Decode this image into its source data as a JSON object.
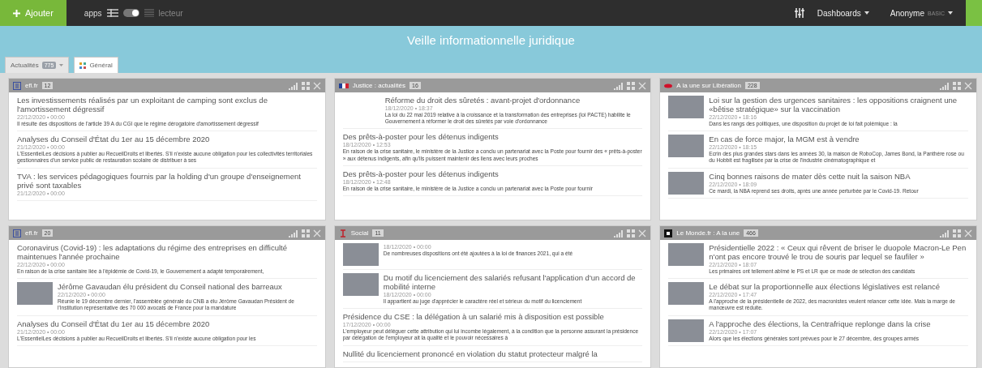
{
  "topbar": {
    "add_button": "Ajouter",
    "apps_label": "apps",
    "mode_toggle_on": true,
    "reader_label": "lecteur",
    "dashboards_menu": "Dashboards",
    "user_name": "Anonyme",
    "user_plan": "BASIC"
  },
  "banner": {
    "title": "Veille informationnelle juridique"
  },
  "tabs": [
    {
      "label": "Actualités",
      "count": "775",
      "kind": "group",
      "selected": false
    },
    {
      "label": "Général",
      "kind": "page",
      "selected": true
    }
  ],
  "panels": [
    {
      "source": "efl.fr",
      "count": "12",
      "items": [
        {
          "kind": "text",
          "title": "Les investissements réalisés par un exploitant de camping sont exclus de l'amortissement dégressif",
          "date": "22/12/2020 • 00:00",
          "summary": "Il résulte des dispositions de l'article 39 A du CGI que le régime dérogatoire d'amortissement dégressif"
        },
        {
          "kind": "text",
          "title": "Analyses du Conseil d'État du 1er au 15 décembre 2020",
          "date": "21/12/2020 • 00:00",
          "summary": "L'EssentielLes décisions à publier au RecueilDroits et libertés. S'il n'existe aucune obligation pour les collectivités territoriales gestionnaires d'un service public de restauration scolaire de distribuer à ses"
        },
        {
          "kind": "text",
          "title": "TVA : les services pédagogiques fournis par la holding d'un groupe d'enseignement privé sont taxables",
          "date": "21/12/2020 • 00:00"
        }
      ]
    },
    {
      "source": "Justice : actualités",
      "count": "16",
      "items": [
        {
          "kind": "blank-thumb",
          "title": "Réforme du droit des sûretés : avant-projet d'ordonnance",
          "date": "18/12/2020 • 18:37",
          "summary": "La loi du 22 mai 2019 relative à la croissance et la transformation des entreprises (loi PACTE) habilite le Gouvernement à réformer le droit des sûretés par voie d'ordonnance"
        },
        {
          "kind": "text",
          "title": "Des prêts-à-poster pour les détenus indigents",
          "date": "18/12/2020 • 12:53",
          "summary": "En raison de la crise sanitaire, le ministère de la Justice a conclu un partenariat avec la Poste pour fournir des « prêts-à-poster » aux détenus indigents, afin qu'ils puissent maintenir des liens avec leurs proches"
        },
        {
          "kind": "text",
          "title": "Des prêts-à-poster pour les détenus indigents",
          "date": "18/12/2020 • 12:48",
          "summary": "En raison de la crise sanitaire, le ministère de la Justice a conclu un partenariat avec la Poste pour fournir"
        }
      ]
    },
    {
      "source": "A la une sur Libération",
      "count": "228",
      "items": [
        {
          "kind": "thumb",
          "title": "Loi sur la gestion des urgences sanitaires : les oppositions craignent une «bêtise stratégique» sur la vaccination",
          "date": "22/12/2020 • 18:16",
          "summary": "Dans les rangs des politiques, une disposition du projet de loi fait polémique : la"
        },
        {
          "kind": "thumb",
          "title": "En cas de force major, la MGM est à vendre",
          "date": "22/12/2020 • 18:15",
          "summary": "Ecrin des plus grandes stars dans les années 30, la maison de RoboCop, James Bond, la Panthère rose ou du Hobbit est fragilisée par la crise de l'industrie cinématographique et"
        },
        {
          "kind": "thumb",
          "title": "Cinq bonnes raisons de mater dès cette nuit la saison NBA",
          "date": "22/12/2020 • 18:09",
          "summary": "Ce mardi, la NBA reprend ses droits, après une année perturbée par le Covid-19. Retour"
        }
      ]
    },
    {
      "source": "efl.fr",
      "count": "20",
      "items": [
        {
          "kind": "text",
          "title": "Coronavirus (Covid-19) : les adaptations du régime des entreprises en difficulté maintenues l'année prochaine",
          "date": "22/12/2020 • 00:00",
          "summary": "En raison de la crise sanitaire liée à l'épidémie de Covid-19, le Gouvernement a adapté temporairement,"
        },
        {
          "kind": "thumb",
          "title": "Jérôme Gavaudan élu président du Conseil national des barreaux",
          "date": "22/12/2020 • 00:00",
          "summary": "Réunie le 19 décembre dernier, l'assemblée générale du CNB a élu Jérôme Gavaudan Président de l'Institution représentative des 70 000 avocats de France pour la mandature"
        },
        {
          "kind": "text",
          "title": "Analyses du Conseil d'État du 1er au 15 décembre 2020",
          "date": "21/12/2020 • 00:00",
          "summary": "L'EssentielLes décisions à publier au RecueilDroits et libertés. S'il n'existe aucune obligation pour les"
        }
      ]
    },
    {
      "source": "Social",
      "count": "11",
      "items": [
        {
          "kind": "thumb",
          "date": "18/12/2020 • 00:00",
          "summary": "De nombreuses dispositions ont été ajoutées à la loi de finances 2021, qui a été"
        },
        {
          "kind": "thumb",
          "title": "Du motif du licenciement des salariés refusant l'application d'un accord de mobilité interne",
          "date": "18/12/2020 • 00:00",
          "summary": "Il appartient au juge d'apprécier le caractère réel et sérieux du motif du licenciement"
        },
        {
          "kind": "text",
          "title": "Présidence du CSE : la délégation à un salarié mis à disposition est possible",
          "date": "17/12/2020 • 00:00",
          "summary": "L'employeur peut déléguer cette attribution qui lui incombe légalement, à la condition que la personne assurant la présidence par délégation de l'employeur ait la qualité et le pouvoir nécessaires à"
        },
        {
          "kind": "text",
          "title": "Nullité du licenciement prononcé en violation du statut protecteur malgré la"
        }
      ]
    },
    {
      "source": "Le Monde.fr : A la une",
      "count": "466",
      "items": [
        {
          "kind": "thumb",
          "title": "Présidentielle 2022 : « Ceux qui rêvent de briser le duopole Macron-Le Pen n'ont pas encore trouvé le trou de souris par lequel se faufiler »",
          "date": "22/12/2020 • 18:07",
          "summary": "Les primaires ont tellement abîmé le PS et LR que ce mode de sélection des candidats"
        },
        {
          "kind": "thumb",
          "title": "Le débat sur la proportionnelle aux élections législatives est relancé",
          "date": "22/12/2020 • 17:47",
          "summary": "A l'approche de la présidentielle de 2022, des macronistes veulent relancer cette idée. Mais la marge de manœuvre est réduite."
        },
        {
          "kind": "thumb",
          "title": "A l'approche des élections, la Centrafrique replonge dans la crise",
          "date": "22/12/2020 • 17:07",
          "summary": "Alors que les élections générales sont prévues pour le 27 décembre, des groupes armés"
        }
      ]
    }
  ]
}
